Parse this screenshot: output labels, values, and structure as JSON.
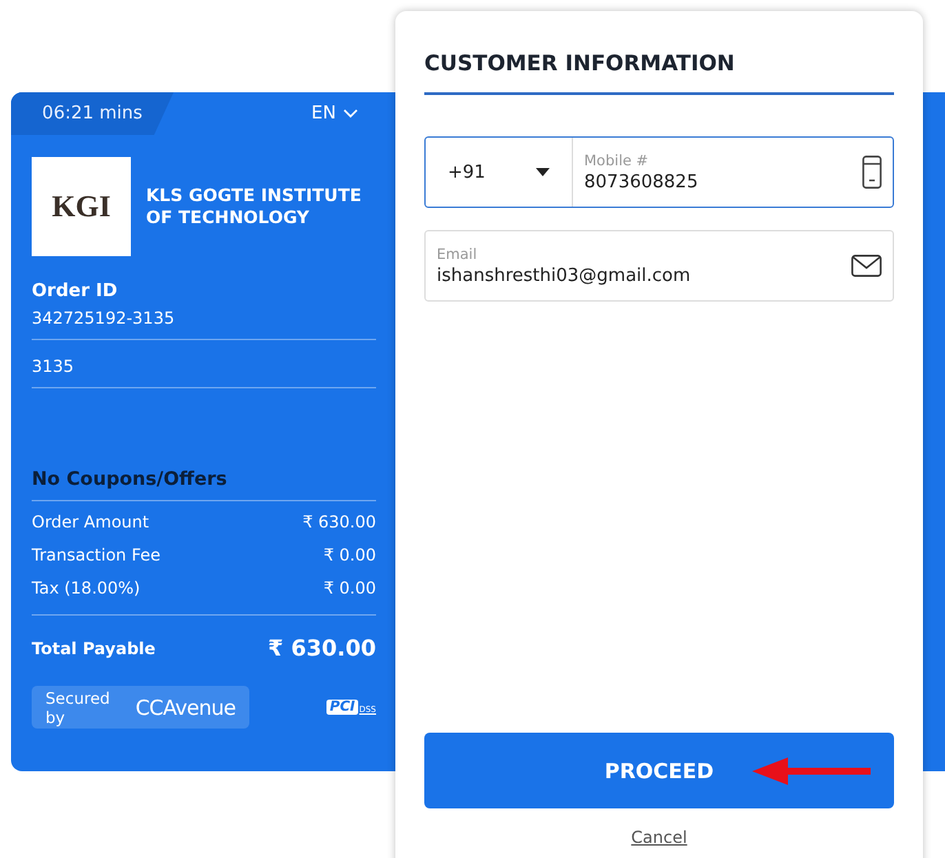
{
  "timer": "06:21 mins",
  "language": "EN",
  "merchant": {
    "logo_text": "KGI",
    "name": "KLS GOGTE INSTITUTE OF TECHNOLOGY"
  },
  "order": {
    "label": "Order ID",
    "id": "342725192-3135",
    "reference": "3135"
  },
  "coupons": "No Coupons/Offers",
  "charges": [
    {
      "label": "Order Amount",
      "amount": "₹ 630.00"
    },
    {
      "label": "Transaction Fee",
      "amount": "₹ 0.00"
    },
    {
      "label": "Tax (18.00%)",
      "amount": "₹ 0.00"
    }
  ],
  "total": {
    "label": "Total Payable",
    "amount": "₹ 630.00"
  },
  "secured": {
    "label": "Secured by",
    "brand": "CCAvenue"
  },
  "pci": {
    "text": "PCI",
    "sub": "DSS"
  },
  "form": {
    "title": "CUSTOMER INFORMATION",
    "country_code": "+91",
    "mobile": {
      "label": "Mobile #",
      "value": "8073608825",
      "focused": true
    },
    "email": {
      "label": "Email",
      "value": "ishanshresthi03@gmail.com",
      "focused": false
    }
  },
  "proceed": "PROCEED",
  "cancel": "Cancel"
}
